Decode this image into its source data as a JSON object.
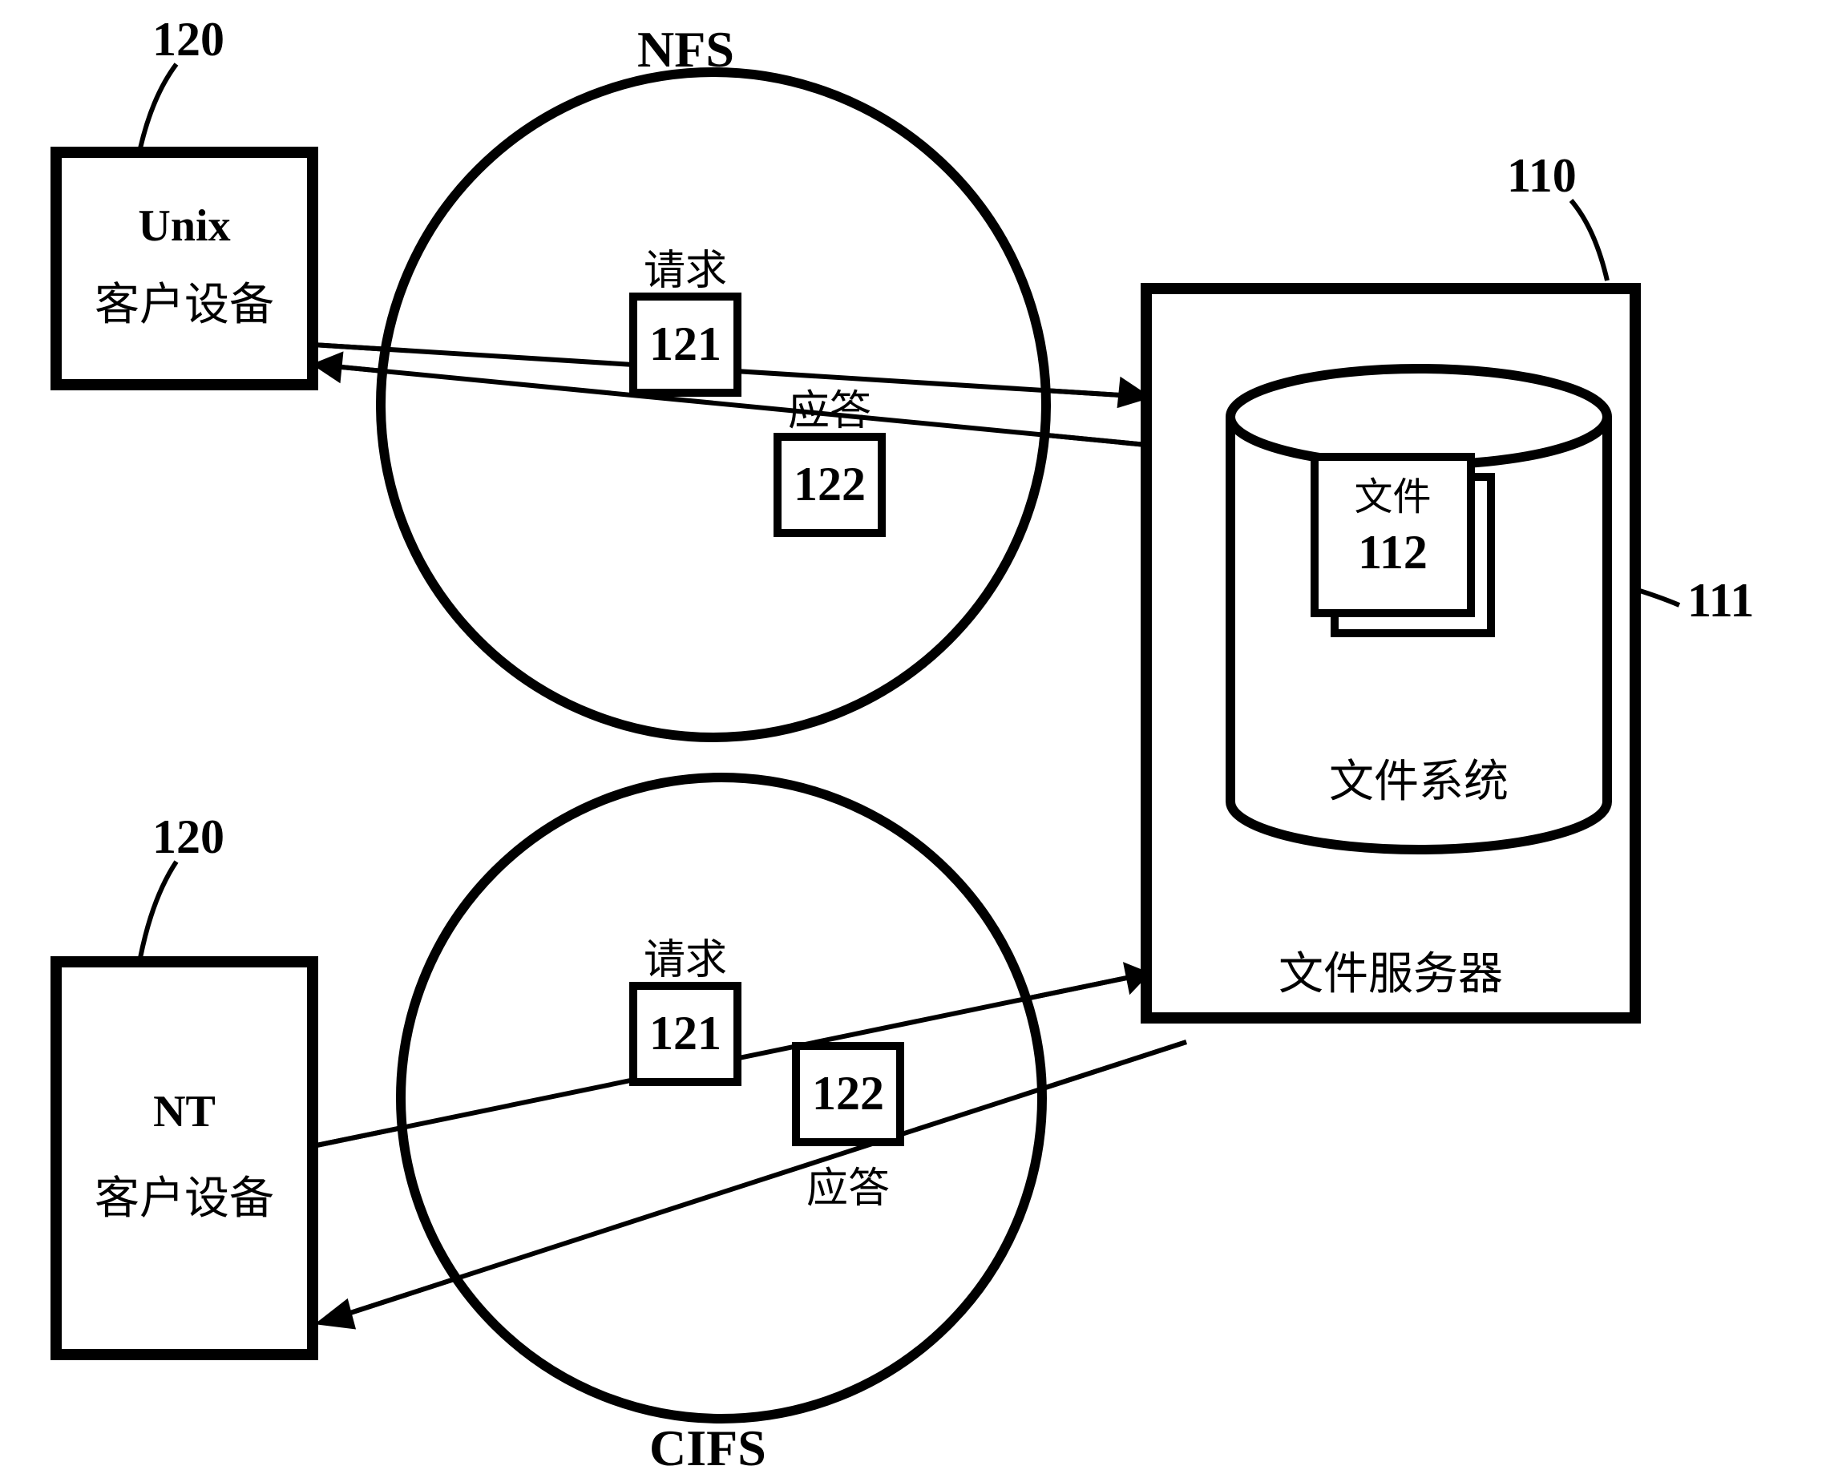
{
  "clients": {
    "top": {
      "ref": "120",
      "line1": "Unix",
      "line2": "客户设备"
    },
    "bottom": {
      "ref": "120",
      "line1": "NT",
      "line2": "客户设备"
    }
  },
  "protocols": {
    "top": {
      "name": "NFS",
      "request_label": "请求",
      "request_num": "121",
      "response_label": "应答",
      "response_num": "122"
    },
    "bottom": {
      "name": "CIFS",
      "request_label": "请求",
      "request_num": "121",
      "response_label": "应答",
      "response_num": "122"
    }
  },
  "server": {
    "ref": "110",
    "caption": "文件服务器",
    "cylinder_ref": "111",
    "cylinder_label": "文件系统",
    "file_label": "文件",
    "file_num": "112"
  }
}
